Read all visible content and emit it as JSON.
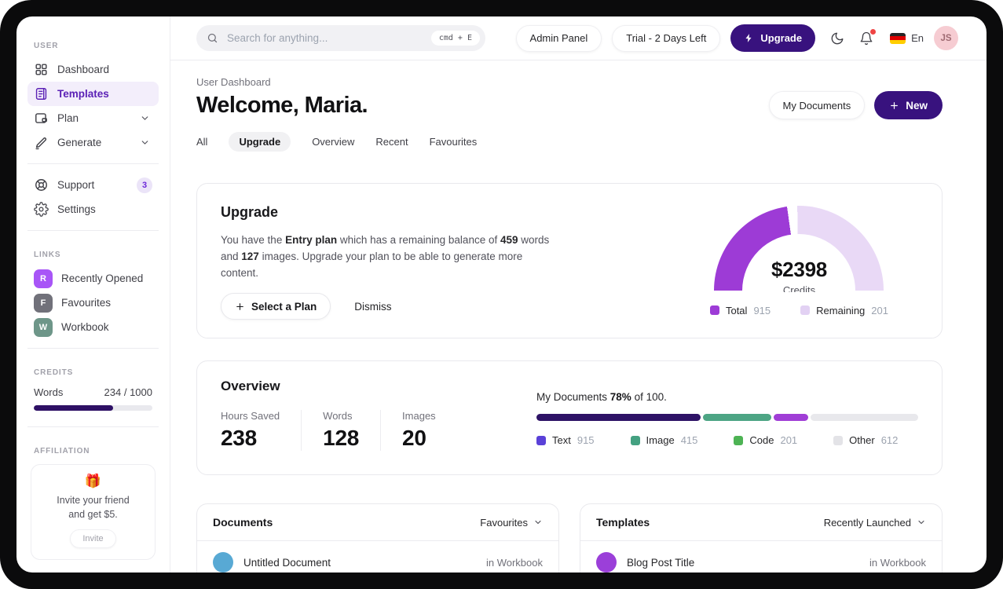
{
  "topbar": {
    "search": {
      "placeholder": "Search for anything...",
      "shortcut": "cmd + E"
    },
    "admin_panel_label": "Admin Panel",
    "trial_label": "Trial - 2 Days Left",
    "upgrade_label": "Upgrade",
    "language_label": "En",
    "avatar_initials": "JS",
    "accent_color": "#38127e",
    "notification_dot_color": "#ef4444"
  },
  "sidebar": {
    "user_label": "USER",
    "nav": [
      {
        "label": "Dashboard"
      },
      {
        "label": "Templates"
      },
      {
        "label": "Plan"
      },
      {
        "label": "Generate"
      }
    ],
    "support": {
      "label": "Support",
      "badge": "3"
    },
    "settings": {
      "label": "Settings"
    },
    "links_label": "LINKS",
    "links": [
      {
        "label": "Recently Opened",
        "letter": "R",
        "color": "#a855f7"
      },
      {
        "label": "Favourites",
        "letter": "F",
        "color": "#71717a"
      },
      {
        "label": "Workbook",
        "letter": "W",
        "color": "#6e9689"
      }
    ],
    "credits_label": "CREDITS",
    "credits": {
      "label": "Words",
      "value": "234 / 1000",
      "percent_filled": 67,
      "bar_color": "#2e1065"
    },
    "affiliation_label": "AFFILIATION",
    "affiliation": {
      "emoji": "🎁",
      "line1": "Invite your friend",
      "line2": "and get $5.",
      "button_label": "Invite"
    }
  },
  "header": {
    "breadcrumb": "User Dashboard",
    "title": "Welcome, Maria.",
    "my_documents_label": "My Documents",
    "new_label": "New",
    "tabs": [
      {
        "label": "All"
      },
      {
        "label": "Upgrade",
        "active": true
      },
      {
        "label": "Overview"
      },
      {
        "label": "Recent"
      },
      {
        "label": "Favourites"
      }
    ]
  },
  "upgrade_card": {
    "title": "Upgrade",
    "body": {
      "t1": "You have the ",
      "b1": "Entry plan",
      "t2": " which has a remaining balance of ",
      "b2": "459",
      "t3": " words and ",
      "b3": "127",
      "t4": " images. Upgrade your plan to be able to generate more content."
    },
    "select_plan_label": "Select a Plan",
    "dismiss_label": "Dismiss",
    "gauge": {
      "center_value": "$2398",
      "center_label": "Credits",
      "filled_deg": 82,
      "gap_deg": 7,
      "filled_color": "#9d3bd6",
      "remaining_color": "#e9d9f6",
      "legend": [
        {
          "label": "Total",
          "value": "915",
          "color": "#9d3bd6"
        },
        {
          "label": "Remaining",
          "value": "201",
          "color": "#e2d1f3"
        }
      ]
    }
  },
  "overview_card": {
    "title": "Overview",
    "stats": [
      {
        "label": "Hours Saved",
        "value": "238"
      },
      {
        "label": "Words",
        "value": "128"
      },
      {
        "label": "Images",
        "value": "20"
      }
    ],
    "docs_line": {
      "t1": "My Documents ",
      "b1": "78%",
      "t2": " of 100."
    },
    "bar": {
      "segments": [
        {
          "color": "#2e1366",
          "width_pct": 43
        },
        {
          "color": "#4da584",
          "width_pct": 18
        },
        {
          "color": "#a03ed6",
          "width_pct": 9
        }
      ],
      "track_color": "#e8e8ec"
    },
    "legend": [
      {
        "label": "Text",
        "value": "915",
        "color": "#5a41d8"
      },
      {
        "label": "Image",
        "value": "415",
        "color": "#44a181"
      },
      {
        "label": "Code",
        "value": "201",
        "color": "#4db354"
      },
      {
        "label": "Other",
        "value": "612",
        "color": "#e3e3e7"
      }
    ]
  },
  "documents_card": {
    "title": "Documents",
    "filter_label": "Favourites",
    "rows": [
      {
        "title": "Untitled Document",
        "location": "in Workbook",
        "avatar_color": "#58a9d4"
      }
    ]
  },
  "templates_card": {
    "title": "Templates",
    "filter_label": "Recently Launched",
    "rows": [
      {
        "title": "Blog Post Title",
        "location": "in Workbook",
        "avatar_color": "#9b3fd9"
      }
    ]
  }
}
